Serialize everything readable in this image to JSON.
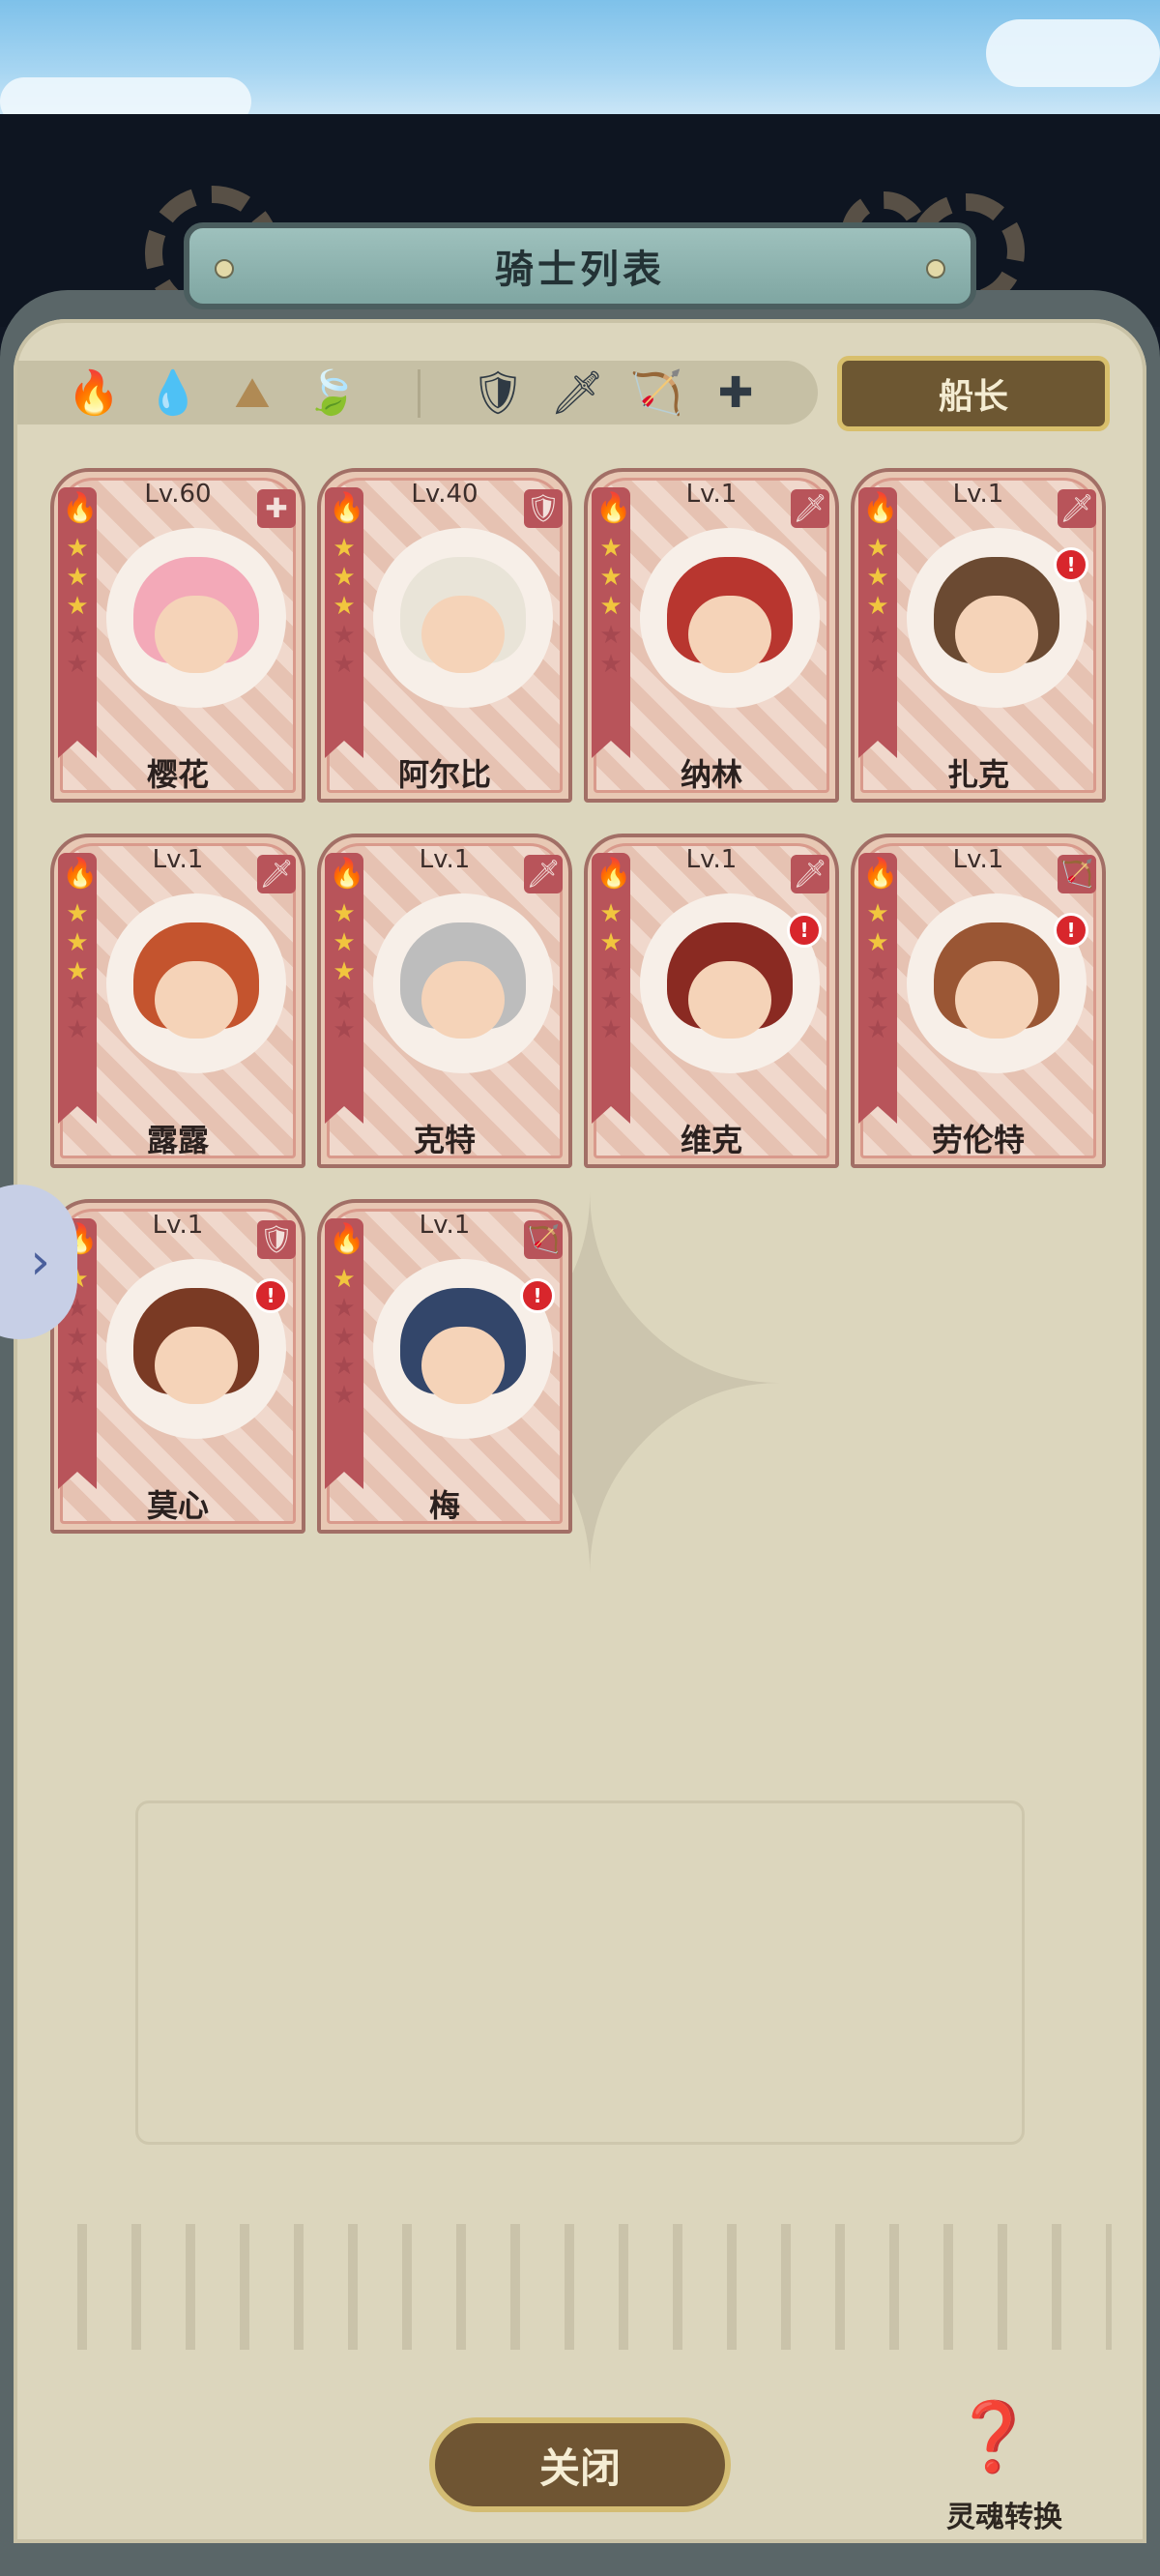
{
  "window": {
    "title": "骑士列表"
  },
  "filters": {
    "elements": [
      {
        "name": "fire-element-filter-icon",
        "glyph": "🔥",
        "color": "#c84a3a"
      },
      {
        "name": "water-element-filter-icon",
        "glyph": "💧",
        "color": "#5a85c2"
      },
      {
        "name": "earth-element-filter-icon",
        "glyph": "⛰",
        "color": "#b08a54"
      },
      {
        "name": "wind-element-filter-icon",
        "glyph": "🍃",
        "color": "#8aa05a"
      }
    ],
    "classes": [
      {
        "name": "tank-class-filter-icon",
        "glyph": "🛡"
      },
      {
        "name": "warrior-class-filter-icon",
        "glyph": "🗡"
      },
      {
        "name": "ranger-class-filter-icon",
        "glyph": "🏹"
      },
      {
        "name": "support-class-filter-icon",
        "glyph": "✚"
      }
    ],
    "captain_label": "船长"
  },
  "knights": [
    {
      "level": "Lv.60",
      "name": "樱花",
      "stars": 3,
      "class_icon": "✚",
      "alert": false,
      "portrait_color": "#f3a9b8"
    },
    {
      "level": "Lv.40",
      "name": "阿尔比",
      "stars": 3,
      "class_icon": "🛡",
      "alert": false,
      "portrait_color": "#e9e4d8"
    },
    {
      "level": "Lv.1",
      "name": "纳林",
      "stars": 3,
      "class_icon": "🗡",
      "alert": false,
      "portrait_color": "#b8362f"
    },
    {
      "level": "Lv.1",
      "name": "扎克",
      "stars": 3,
      "class_icon": "🗡",
      "alert": true,
      "portrait_color": "#6b4a32"
    },
    {
      "level": "Lv.1",
      "name": "露露",
      "stars": 3,
      "class_icon": "🗡",
      "alert": false,
      "portrait_color": "#c4542e"
    },
    {
      "level": "Lv.1",
      "name": "克特",
      "stars": 3,
      "class_icon": "🗡",
      "alert": false,
      "portrait_color": "#bdbdbd"
    },
    {
      "level": "Lv.1",
      "name": "维克",
      "stars": 2,
      "class_icon": "🗡",
      "alert": true,
      "portrait_color": "#8a2a22"
    },
    {
      "level": "Lv.1",
      "name": "劳伦特",
      "stars": 2,
      "class_icon": "🏹",
      "alert": true,
      "portrait_color": "#9a5634"
    },
    {
      "level": "Lv.1",
      "name": "莫心",
      "stars": 1,
      "class_icon": "🛡",
      "alert": true,
      "portrait_color": "#7a3a24"
    },
    {
      "level": "Lv.1",
      "name": "梅",
      "stars": 1,
      "class_icon": "🏹",
      "alert": true,
      "portrait_color": "#33466a"
    }
  ],
  "element_icon": "🔥",
  "buttons": {
    "close": "关闭",
    "soul_convert": "灵魂转换"
  },
  "side_tab": {
    "glyph": "›"
  },
  "colors": {
    "accent_gold": "#d8bf6c",
    "panel_bg": "#dcd6bd",
    "card_red": "#b8545a"
  }
}
